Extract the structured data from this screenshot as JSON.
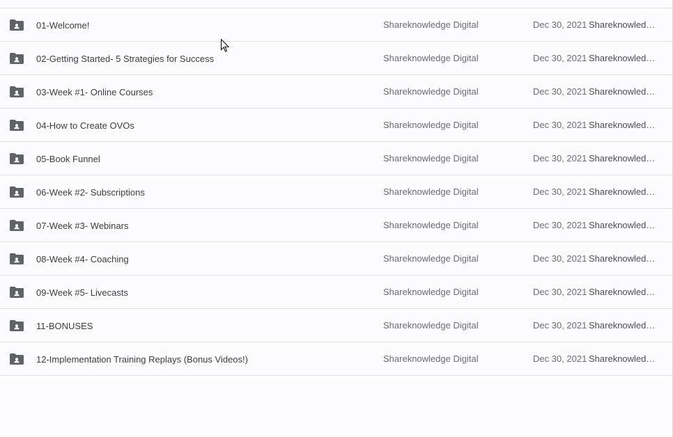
{
  "colors": {
    "background": "#fcfbfd",
    "divider": "#e0e0e3",
    "icon": "#5f6368",
    "name_text": "#3c3c40",
    "meta_text": "#6b6b72"
  },
  "icons": {
    "row_icon": "shared-folder-icon",
    "pointer": "mouse-cursor-icon"
  },
  "files": [
    {
      "name": "01-Welcome!",
      "owner": "Shareknowledge Digital",
      "date": "Dec 30, 2021",
      "modified_by": "Shareknowledge Digital"
    },
    {
      "name": "02-Getting Started- 5 Strategies for Success",
      "owner": "Shareknowledge Digital",
      "date": "Dec 30, 2021",
      "modified_by": "Shareknowledge Digital"
    },
    {
      "name": "03-Week #1- Online Courses",
      "owner": "Shareknowledge Digital",
      "date": "Dec 30, 2021",
      "modified_by": "Shareknowledge Digital"
    },
    {
      "name": "04-How to Create OVOs",
      "owner": "Shareknowledge Digital",
      "date": "Dec 30, 2021",
      "modified_by": "Shareknowledge Digital"
    },
    {
      "name": "05-Book Funnel",
      "owner": "Shareknowledge Digital",
      "date": "Dec 30, 2021",
      "modified_by": "Shareknowledge Digital"
    },
    {
      "name": "06-Week #2- Subscriptions",
      "owner": "Shareknowledge Digital",
      "date": "Dec 30, 2021",
      "modified_by": "Shareknowledge Digital"
    },
    {
      "name": "07-Week #3- Webinars",
      "owner": "Shareknowledge Digital",
      "date": "Dec 30, 2021",
      "modified_by": "Shareknowledge Digital"
    },
    {
      "name": "08-Week #4- Coaching",
      "owner": "Shareknowledge Digital",
      "date": "Dec 30, 2021",
      "modified_by": "Shareknowledge Digital"
    },
    {
      "name": "09-Week #5- Livecasts",
      "owner": "Shareknowledge Digital",
      "date": "Dec 30, 2021",
      "modified_by": "Shareknowledge Digital"
    },
    {
      "name": "11-BONUSES",
      "owner": "Shareknowledge Digital",
      "date": "Dec 30, 2021",
      "modified_by": "Shareknowledge Digital"
    },
    {
      "name": "12-Implementation Training Replays (Bonus Videos!)",
      "owner": "Shareknowledge Digital",
      "date": "Dec 30, 2021",
      "modified_by": "Shareknowledge Digital"
    }
  ]
}
